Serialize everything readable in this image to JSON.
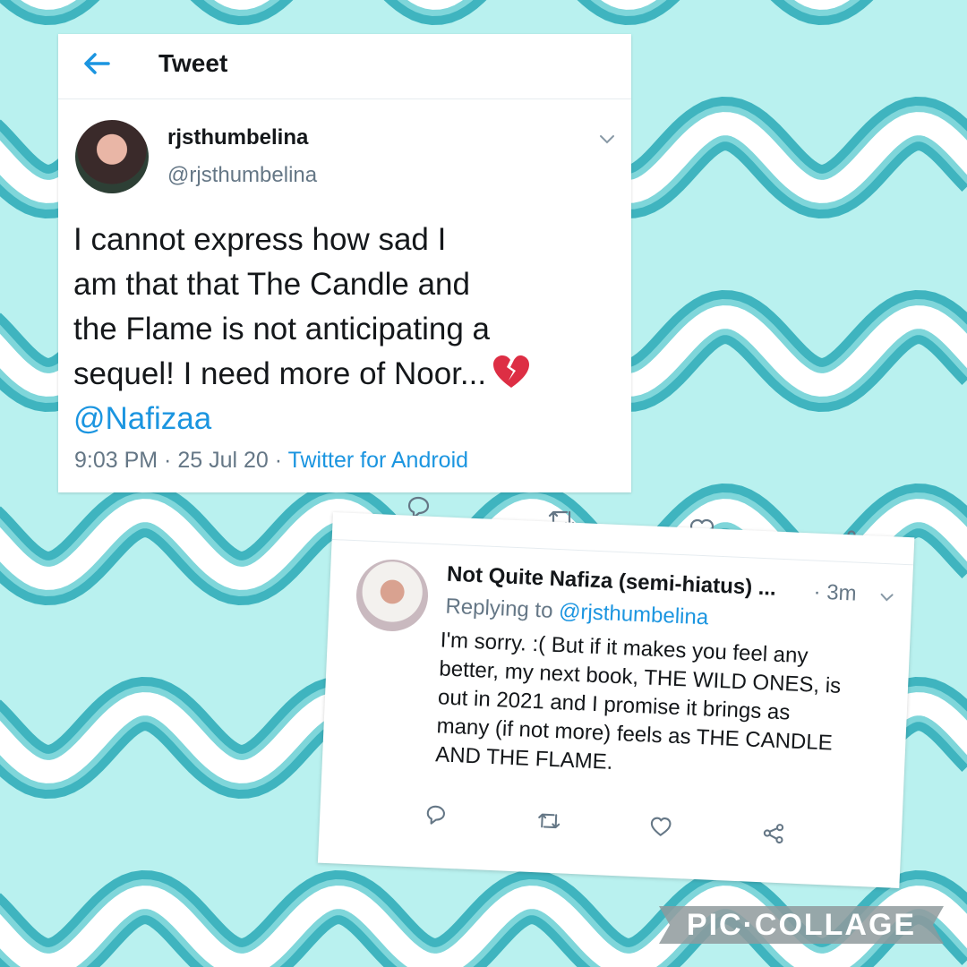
{
  "colors": {
    "background": "#b9f1ef",
    "wave_dark": "#3fb4bf",
    "wave_mid": "#7fd6da",
    "wave_white": "#ffffff",
    "link": "#1b95e0",
    "text": "#14171a",
    "muted": "#657786"
  },
  "tweet": {
    "header_title": "Tweet",
    "back_icon": "arrow-left-icon",
    "display_name": "rjsthumbelina",
    "handle": "@rjsthumbelina",
    "body_lines": [
      "I cannot express how sad I",
      "am that that The Candle and",
      "the Flame is not anticipating a",
      "sequel! I need more of Noor..."
    ],
    "emoji_icon": "broken-heart-icon",
    "mention": "@Nafizaa",
    "time": "9:03 PM",
    "date": "25 Jul 20",
    "source": "Twitter for Android",
    "separator": " · ",
    "action_icons": [
      "reply-icon",
      "retweet-icon",
      "like-icon",
      "share-icon"
    ]
  },
  "reply": {
    "display_name": "Not Quite Nafiza (semi-hiatus) ...",
    "time": "· 3m",
    "replying_prefix": "Replying to",
    "replying_handle": "@rjsthumbelina",
    "body_lines": [
      "I'm sorry. :( But if it makes you feel any",
      "better, my next book, THE WILD ONES, is",
      "out in 2021 and I promise it brings as",
      "many (if not more) feels as THE CANDLE",
      "AND THE FLAME."
    ],
    "action_icons": [
      "reply-icon",
      "retweet-icon",
      "like-icon",
      "share-icon"
    ]
  },
  "watermark": {
    "text": "PIC·COLLAGE"
  }
}
